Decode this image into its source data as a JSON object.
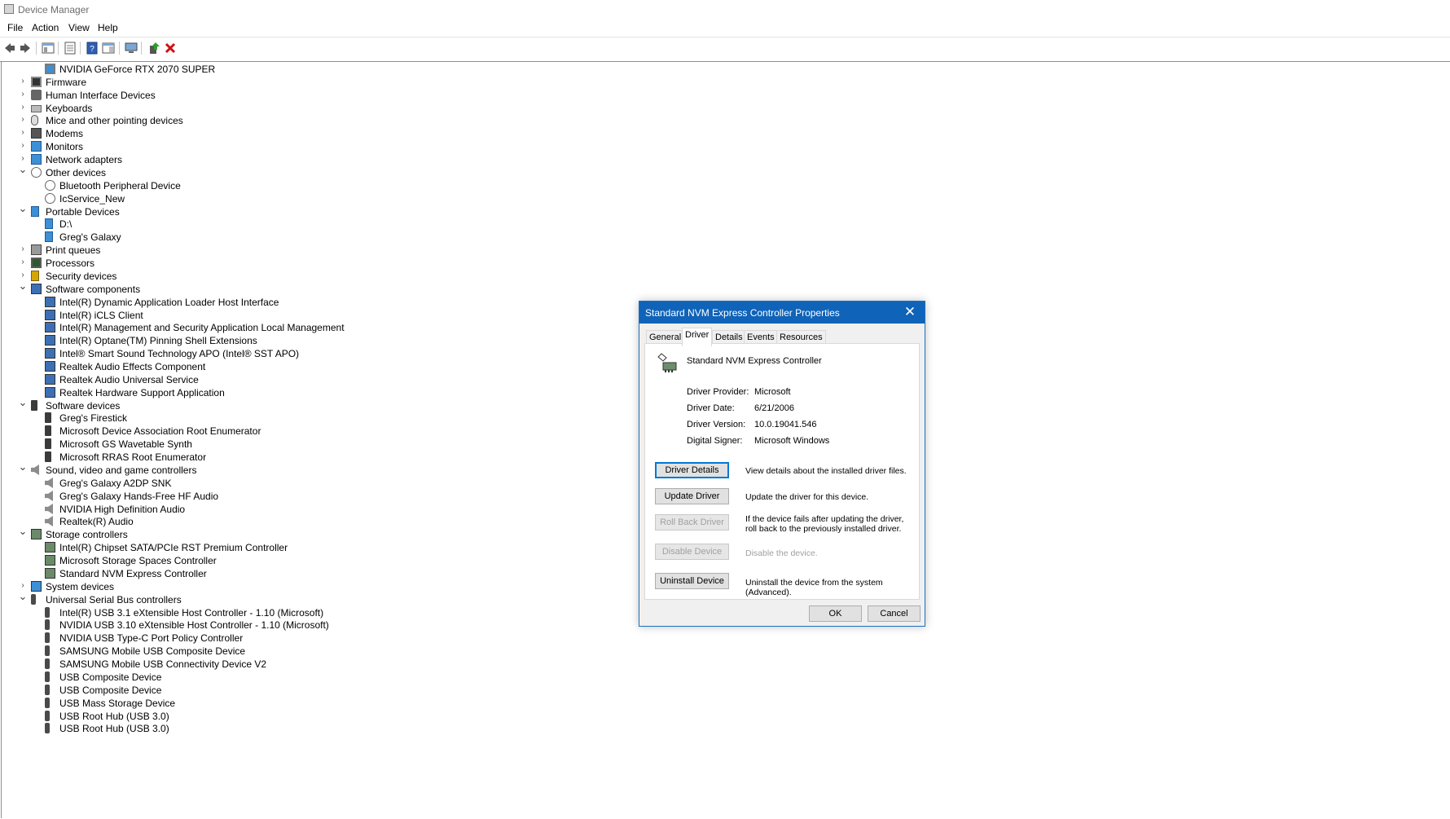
{
  "window": {
    "title": "Device Manager"
  },
  "menu": [
    "File",
    "Action",
    "View",
    "Help"
  ],
  "toolbar": {
    "buttons": [
      "back-icon",
      "forward-icon",
      "show-hide-console-tree-icon",
      "properties-icon",
      "help-icon",
      "action-pane-icon",
      "scan-hardware-icon",
      "update-driver-icon",
      "uninstall-icon"
    ]
  },
  "tree": [
    {
      "label": "NVIDIA GeForce RTX 2070 SUPER",
      "level": 1,
      "icon": "monitor"
    },
    {
      "label": "Firmware",
      "level": 0,
      "state": "collapsed",
      "icon": "chip"
    },
    {
      "label": "Human Interface Devices",
      "level": 0,
      "state": "collapsed",
      "icon": "hid"
    },
    {
      "label": "Keyboards",
      "level": 0,
      "state": "collapsed",
      "icon": "kbd"
    },
    {
      "label": "Mice and other pointing devices",
      "level": 0,
      "state": "collapsed",
      "icon": "mouse"
    },
    {
      "label": "Modems",
      "level": 0,
      "state": "collapsed",
      "icon": "modem"
    },
    {
      "label": "Monitors",
      "level": 0,
      "state": "collapsed",
      "icon": "net"
    },
    {
      "label": "Network adapters",
      "level": 0,
      "state": "collapsed",
      "icon": "net"
    },
    {
      "label": "Other devices",
      "level": 0,
      "state": "expanded",
      "icon": "other"
    },
    {
      "label": "Bluetooth Peripheral Device",
      "level": 1,
      "icon": "other"
    },
    {
      "label": "IcService_New",
      "level": 1,
      "icon": "other"
    },
    {
      "label": "Portable Devices",
      "level": 0,
      "state": "expanded",
      "icon": "port"
    },
    {
      "label": "D:\\",
      "level": 1,
      "icon": "port"
    },
    {
      "label": "Greg's Galaxy",
      "level": 1,
      "icon": "port"
    },
    {
      "label": "Print queues",
      "level": 0,
      "state": "collapsed",
      "icon": "print"
    },
    {
      "label": "Processors",
      "level": 0,
      "state": "collapsed",
      "icon": "proc"
    },
    {
      "label": "Security devices",
      "level": 0,
      "state": "collapsed",
      "icon": "sec"
    },
    {
      "label": "Software components",
      "level": 0,
      "state": "expanded",
      "icon": "swc"
    },
    {
      "label": "Intel(R) Dynamic Application Loader Host Interface",
      "level": 1,
      "icon": "swc"
    },
    {
      "label": "Intel(R) iCLS Client",
      "level": 1,
      "icon": "swc"
    },
    {
      "label": "Intel(R) Management and Security Application Local Management",
      "level": 1,
      "icon": "swc"
    },
    {
      "label": "Intel(R) Optane(TM) Pinning Shell Extensions",
      "level": 1,
      "icon": "swc"
    },
    {
      "label": "Intel® Smart Sound Technology APO (Intel® SST APO)",
      "level": 1,
      "icon": "swc"
    },
    {
      "label": "Realtek Audio Effects Component",
      "level": 1,
      "icon": "swc"
    },
    {
      "label": "Realtek Audio Universal Service",
      "level": 1,
      "icon": "swc"
    },
    {
      "label": "Realtek Hardware Support Application",
      "level": 1,
      "icon": "swc"
    },
    {
      "label": "Software devices",
      "level": 0,
      "state": "expanded",
      "icon": "swd"
    },
    {
      "label": "Greg's Firestick",
      "level": 1,
      "icon": "swd"
    },
    {
      "label": "Microsoft Device Association Root Enumerator",
      "level": 1,
      "icon": "swd"
    },
    {
      "label": "Microsoft GS Wavetable Synth",
      "level": 1,
      "icon": "swd"
    },
    {
      "label": "Microsoft RRAS Root Enumerator",
      "level": 1,
      "icon": "swd"
    },
    {
      "label": "Sound, video and game controllers",
      "level": 0,
      "state": "expanded",
      "icon": "snd"
    },
    {
      "label": "Greg's Galaxy A2DP SNK",
      "level": 1,
      "icon": "snd"
    },
    {
      "label": "Greg's Galaxy Hands-Free HF Audio",
      "level": 1,
      "icon": "snd"
    },
    {
      "label": "NVIDIA High Definition Audio",
      "level": 1,
      "icon": "snd"
    },
    {
      "label": "Realtek(R) Audio",
      "level": 1,
      "icon": "snd"
    },
    {
      "label": "Storage controllers",
      "level": 0,
      "state": "expanded",
      "icon": "stor"
    },
    {
      "label": "Intel(R) Chipset SATA/PCIe RST Premium Controller",
      "level": 1,
      "icon": "stor"
    },
    {
      "label": "Microsoft Storage Spaces Controller",
      "level": 1,
      "icon": "stor"
    },
    {
      "label": "Standard NVM Express Controller",
      "level": 1,
      "icon": "stor"
    },
    {
      "label": "System devices",
      "level": 0,
      "state": "collapsed",
      "icon": "sys"
    },
    {
      "label": "Universal Serial Bus controllers",
      "level": 0,
      "state": "expanded",
      "icon": "usb"
    },
    {
      "label": "Intel(R) USB 3.1 eXtensible Host Controller - 1.10 (Microsoft)",
      "level": 1,
      "icon": "usb"
    },
    {
      "label": "NVIDIA USB 3.10 eXtensible Host Controller - 1.10 (Microsoft)",
      "level": 1,
      "icon": "usb"
    },
    {
      "label": "NVIDIA USB Type-C Port Policy Controller",
      "level": 1,
      "icon": "usb"
    },
    {
      "label": "SAMSUNG Mobile USB Composite Device",
      "level": 1,
      "icon": "usb"
    },
    {
      "label": "SAMSUNG Mobile USB Connectivity Device V2",
      "level": 1,
      "icon": "usb"
    },
    {
      "label": "USB Composite Device",
      "level": 1,
      "icon": "usb"
    },
    {
      "label": "USB Composite Device",
      "level": 1,
      "icon": "usb"
    },
    {
      "label": "USB Mass Storage Device",
      "level": 1,
      "icon": "usb"
    },
    {
      "label": "USB Root Hub (USB 3.0)",
      "level": 1,
      "icon": "usb"
    },
    {
      "label": "USB Root Hub (USB 3.0)",
      "level": 1,
      "icon": "usb"
    }
  ],
  "dialog": {
    "title": "Standard NVM Express Controller Properties",
    "close_glyph": "✕",
    "tabs": [
      "General",
      "Driver",
      "Details",
      "Events",
      "Resources"
    ],
    "active_tab": "Driver",
    "device_name": "Standard NVM Express Controller",
    "fields": [
      {
        "label": "Driver Provider:",
        "value": "Microsoft"
      },
      {
        "label": "Driver Date:",
        "value": "6/21/2006"
      },
      {
        "label": "Driver Version:",
        "value": "10.0.19041.546"
      },
      {
        "label": "Digital Signer:",
        "value": "Microsoft Windows"
      }
    ],
    "actions": [
      {
        "label": "Driver Details",
        "description": "View details about the installed driver files.",
        "enabled": true,
        "focused": true
      },
      {
        "label": "Update Driver",
        "description": "Update the driver for this device.",
        "enabled": true
      },
      {
        "label": "Roll Back Driver",
        "description": "If the device fails after updating the driver, roll back to the previously installed driver.",
        "enabled": false
      },
      {
        "label": "Disable Device",
        "description": "Disable the device.",
        "enabled": false
      },
      {
        "label": "Uninstall Device",
        "description": "Uninstall the device from the system (Advanced).",
        "enabled": true
      }
    ],
    "ok_label": "OK",
    "cancel_label": "Cancel"
  },
  "colors": {
    "dialog_title_bg": "#0f63b8",
    "focus_border": "#0078d7",
    "disabled_text": "#a0a0a0"
  }
}
